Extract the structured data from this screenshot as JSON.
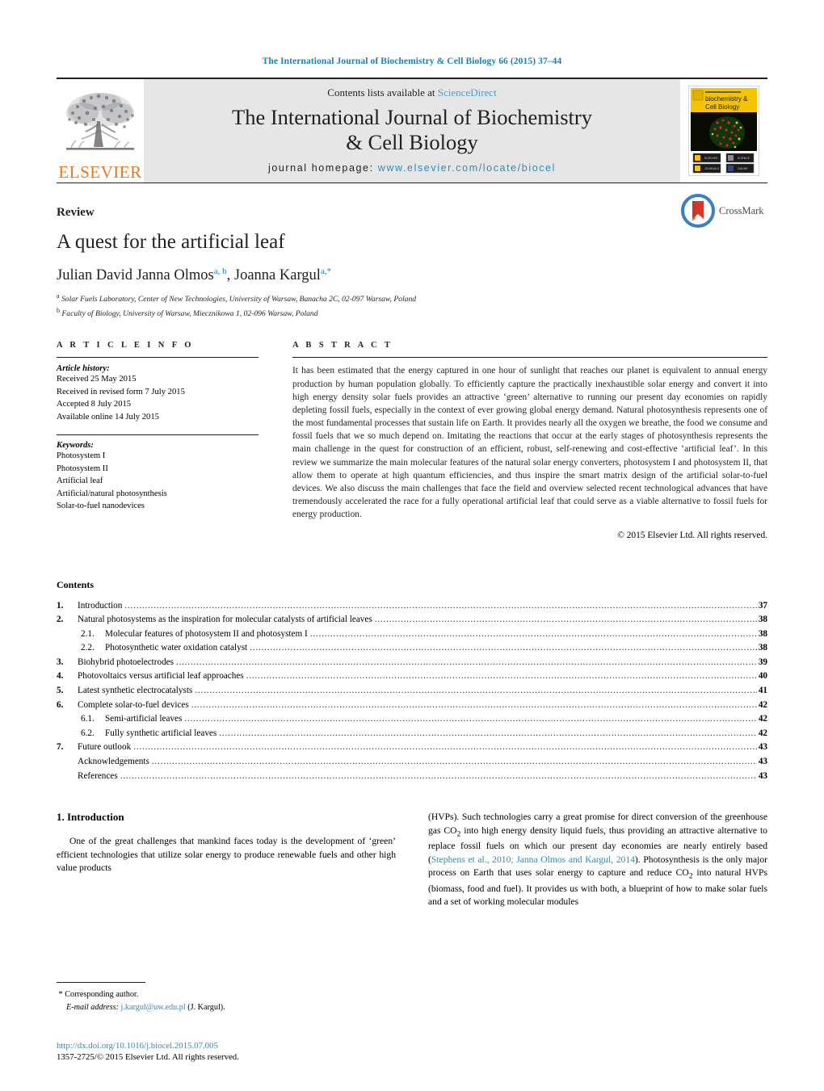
{
  "running_head": "The International Journal of Biochemistry & Cell Biology 66 (2015) 37–44",
  "masthead": {
    "contents_prefix": "Contents lists available at ",
    "sciencedirect": "ScienceDirect",
    "journal_title_line1": "The International Journal of Biochemistry",
    "journal_title_line2": "& Cell Biology",
    "homepage_prefix": "journal homepage: ",
    "homepage_url": "www.elsevier.com/locate/biocel",
    "publisher": "ELSEVIER",
    "cover_title_line1": "The International Journal of",
    "cover_title_line2": "biochemistry &",
    "cover_title_line3": "Cell Biology"
  },
  "article": {
    "doctype": "Review",
    "title": "A quest for the artificial leaf",
    "authors_part1": "Julian David Janna Olmos",
    "authors_sup1": "a, b",
    "authors_sep": ", ",
    "authors_part2": "Joanna Kargul",
    "authors_sup2": "a,*",
    "affiliation_a_marker": "a",
    "affiliation_a": "Solar Fuels Laboratory, Center of New Technologies, University of Warsaw, Banacha 2C, 02-097 Warsaw, Poland",
    "affiliation_b_marker": "b",
    "affiliation_b": "Faculty of Biology, University of Warsaw, Miecznikowa 1, 02-096 Warsaw, Poland",
    "crossmark_label": "CrossMark"
  },
  "article_info": {
    "heading": "A R T I C L E    I N F O",
    "history_label": "Article history:",
    "history": [
      "Received 25 May 2015",
      "Received in revised form 7 July 2015",
      "Accepted 8 July 2015",
      "Available online 14 July 2015"
    ],
    "keywords_label": "Keywords:",
    "keywords": [
      "Photosystem I",
      "Photosystem II",
      "Artificial leaf",
      "Artificial/natural photosynthesis",
      "Solar-to-fuel nanodevices"
    ]
  },
  "abstract": {
    "heading": "A B S T R A C T",
    "text": "It has been estimated that the energy captured in one hour of sunlight that reaches our planet is equivalent to annual energy production by human population globally. To efficiently capture the practically inexhaustible solar energy and convert it into high energy density solar fuels provides an attractive ‘green’ alternative to running our present day economies on rapidly depleting fossil fuels, especially in the context of ever growing global energy demand. Natural photosynthesis represents one of the most fundamental processes that sustain life on Earth. It provides nearly all the oxygen we breathe, the food we consume and fossil fuels that we so much depend on. Imitating the reactions that occur at the early stages of photosynthesis represents the main challenge in the quest for construction of an efficient, robust, self-renewing and cost-effective ‘artificial leaf’. In this review we summarize the main molecular features of the natural solar energy converters, photosystem I and photosystem II, that allow them to operate at high quantum efficiencies, and thus inspire the smart matrix design of the artificial solar-to-fuel devices. We also discuss the main challenges that face the field and overview selected recent technological advances that have tremendously accelerated the race for a fully operational artificial leaf that could serve as a viable alternative to fossil fuels for energy production.",
    "copyright": "© 2015 Elsevier Ltd. All rights reserved."
  },
  "contents": {
    "heading": "Contents",
    "entries": [
      {
        "num": "1.",
        "sub": false,
        "label": "Introduction",
        "page": "37"
      },
      {
        "num": "2.",
        "sub": false,
        "label": "Natural photosystems as the inspiration for molecular catalysts of artificial leaves",
        "page": "38"
      },
      {
        "num": "2.1.",
        "sub": true,
        "label": "Molecular features of photosystem II and photosystem I",
        "page": "38"
      },
      {
        "num": "2.2.",
        "sub": true,
        "label": "Photosynthetic water oxidation catalyst",
        "page": "38"
      },
      {
        "num": "3.",
        "sub": false,
        "label": "Biohybrid photoelectrodes",
        "page": "39"
      },
      {
        "num": "4.",
        "sub": false,
        "label": "Photovoltaics versus artificial leaf approaches",
        "page": "40"
      },
      {
        "num": "5.",
        "sub": false,
        "label": "Latest synthetic electrocatalysts",
        "page": "41"
      },
      {
        "num": "6.",
        "sub": false,
        "label": "Complete solar-to-fuel devices",
        "page": "42"
      },
      {
        "num": "6.1.",
        "sub": true,
        "label": "Semi-artificial leaves",
        "page": "42"
      },
      {
        "num": "6.2.",
        "sub": true,
        "label": "Fully synthetic artificial leaves",
        "page": "42"
      },
      {
        "num": "7.",
        "sub": false,
        "label": "Future outlook",
        "page": "43"
      },
      {
        "num": "",
        "sub": false,
        "label": "Acknowledgements",
        "page": "43"
      },
      {
        "num": "",
        "sub": false,
        "label": "References",
        "page": "43"
      }
    ]
  },
  "body": {
    "section_heading": "1.  Introduction",
    "left_para": "One of the great challenges that mankind faces today is the development of ‘green’ efficient technologies that utilize solar energy to produce renewable fuels and other high value products",
    "right_para_1": "(HVPs). Such technologies carry a great promise for direct conversion of the greenhouse gas CO",
    "right_sub_1": "2",
    "right_para_2": " into high energy density liquid fuels, thus providing an attractive alternative to replace fossil fuels on which our present day economies are nearly entirely based (",
    "right_citation": "Stephens et al., 2010; Janna Olmos and Kargul, 2014",
    "right_para_3": "). Photosynthesis is the only major process on Earth that uses solar energy to capture and reduce CO",
    "right_sub_2": "2",
    "right_para_4": " into natural HVPs (biomass, food and fuel). It provides us with both, a blueprint of how to make solar fuels and a set of working molecular modules"
  },
  "footer": {
    "corresponding_marker": "*",
    "corresponding_label": "Corresponding author.",
    "email_label": "E-mail address:",
    "email": "j.kargul@uw.edu.pl",
    "email_owner": "(J. Kargul).",
    "doi": "http://dx.doi.org/10.1016/j.biocel.2015.07.005",
    "issn_line": "1357-2725/© 2015 Elsevier Ltd. All rights reserved."
  },
  "colors": {
    "link_blue": "#2b8cbe",
    "running_head_blue": "#1f7fad",
    "sciencedirect_blue": "#4a9fd4",
    "elsevier_orange": "#e87722",
    "masthead_grey": "#e6e6e6",
    "cover_yellow": "#f4c400",
    "crossmark_red": "#d6372b"
  }
}
